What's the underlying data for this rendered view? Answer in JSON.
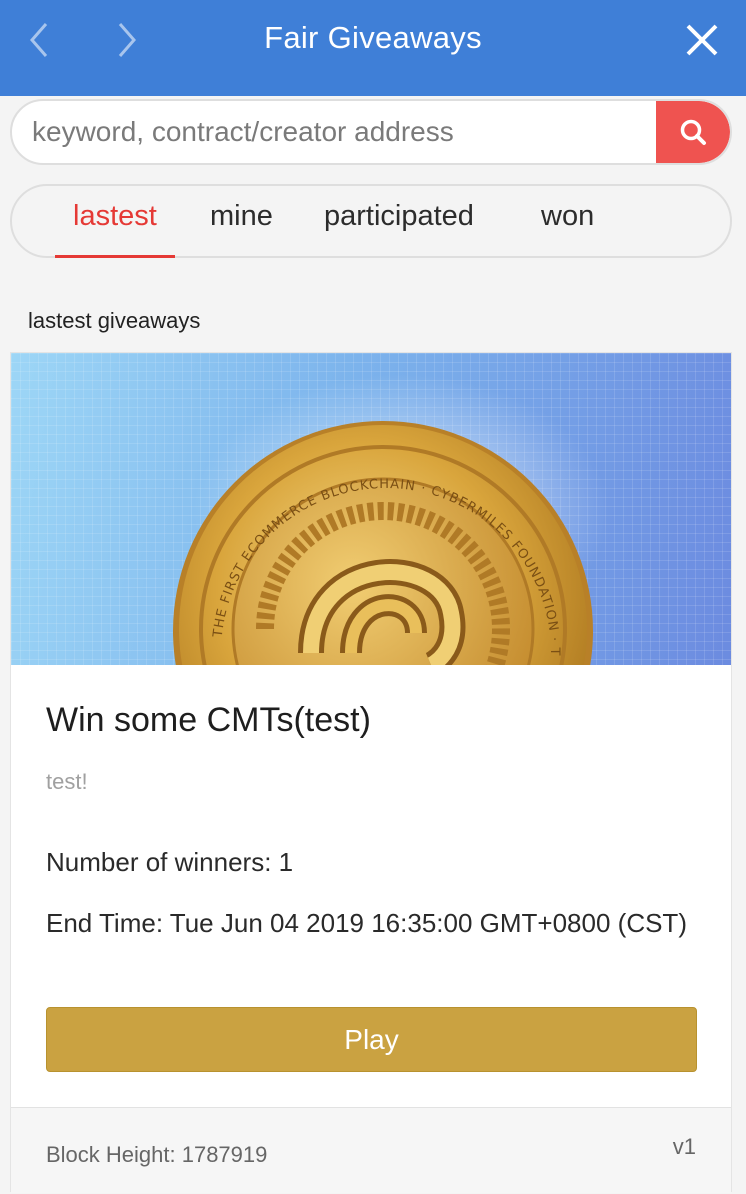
{
  "header": {
    "title": "Fair Giveaways",
    "back_icon": "chevron-left-icon",
    "forward_icon": "chevron-right-icon",
    "close_icon": "close-icon",
    "background_color": "#3f7fd7"
  },
  "search": {
    "placeholder": "keyword, contract/creator address",
    "value": "",
    "button_icon": "search-icon",
    "button_color": "#ef5350"
  },
  "tabs": [
    {
      "label": "lastest",
      "active": true
    },
    {
      "label": "mine",
      "active": false
    },
    {
      "label": "participated",
      "active": false
    },
    {
      "label": "won",
      "active": false
    }
  ],
  "section": {
    "label": "lastest giveaways"
  },
  "giveaway": {
    "banner": "coin-banner-image",
    "coin_text": "THE FIRST ECOMMERCE BLOCKCHAIN · CYBERMILES FOUNDATION · THE FIRST EC",
    "title": "Win some CMTs(test)",
    "description": "test!",
    "winners_text": "Number of winners: 1",
    "end_time_text": "End Time: Tue Jun 04 2019 16:35:00 GMT+0800 (CST)",
    "play_label": "Play",
    "play_color": "#caa241",
    "block_height_text": "Block Height: 1787919",
    "version": "v1"
  }
}
